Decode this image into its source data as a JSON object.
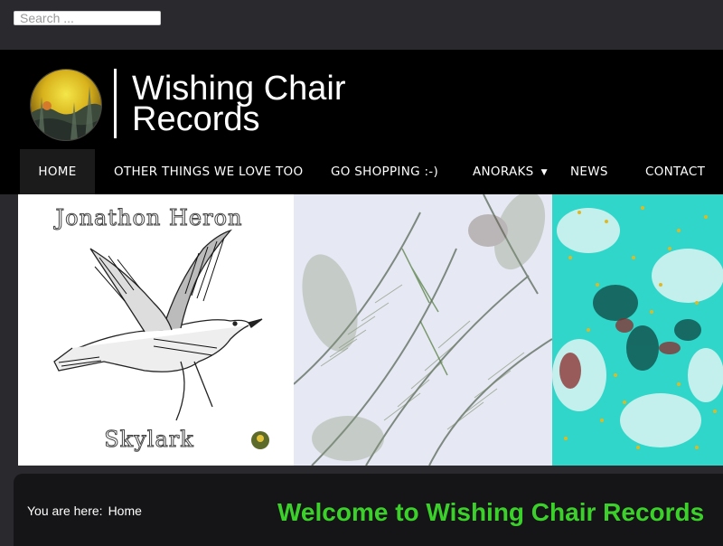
{
  "search": {
    "placeholder": "Search ..."
  },
  "site": {
    "title_line1": "Wishing Chair",
    "title_line2": "Records"
  },
  "nav": {
    "items": [
      {
        "label": "HOME",
        "active": true
      },
      {
        "label": "OTHER THINGS WE LOVE TOO"
      },
      {
        "label": "GO SHOPPING :-)"
      },
      {
        "label": "ANORAKS",
        "has_dropdown": true
      },
      {
        "label": "NEWS"
      },
      {
        "label": "CONTACT"
      }
    ]
  },
  "banner": {
    "album_artist": "Jonathon Heron",
    "album_title": "Skylark"
  },
  "content": {
    "breadcrumb_prefix": "You are here:",
    "breadcrumb_home": "Home",
    "welcome_heading": "Welcome to Wishing Chair Records"
  },
  "colors": {
    "accent": "#3bd12a",
    "header_bg": "#000000",
    "page_bg": "#2a292e"
  }
}
